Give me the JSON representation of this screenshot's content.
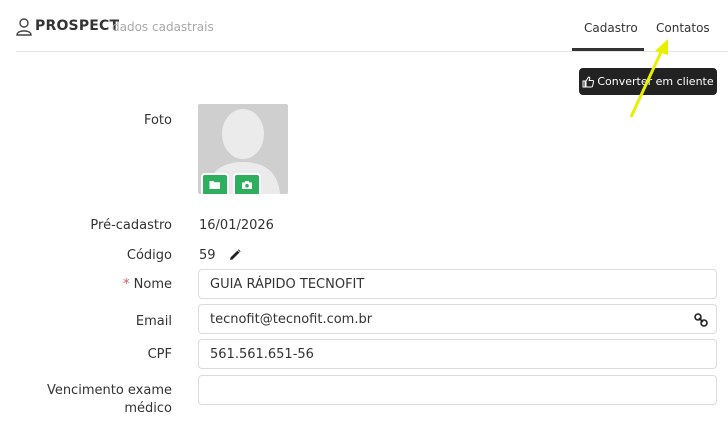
{
  "header": {
    "title": "PROSPECT",
    "subtitle": "dados cadastrais",
    "tabs": [
      {
        "label": "Cadastro",
        "active": true
      },
      {
        "label": "Contatos",
        "active": false
      }
    ]
  },
  "actions": {
    "convert_label": "Converter em cliente"
  },
  "form": {
    "foto_label": "Foto",
    "pre_cadastro_label": "Pré-cadastro",
    "pre_cadastro_value": "16/01/2026",
    "codigo_label": "Código",
    "codigo_value": "59",
    "nome_required": "*",
    "nome_label": "Nome",
    "nome_value": "GUIA RÁPIDO TECNOFIT",
    "email_label": "Email",
    "email_value": "tecnofit@tecnofit.com.br",
    "cpf_label": "CPF",
    "cpf_value": "561.561.651-56",
    "vencimento_label_line1": "Vencimento exame",
    "vencimento_label_line2": "médico",
    "vencimento_value": ""
  },
  "colors": {
    "accent_dark": "#222222",
    "photo_buttons": "#2eaf5e",
    "annotation_arrow": "#e6f000",
    "required": "#d9534f"
  },
  "icons": [
    "user-icon",
    "thumbs-up-icon",
    "folder-icon",
    "camera-icon",
    "pencil-icon",
    "link-icon",
    "avatar-placeholder"
  ]
}
